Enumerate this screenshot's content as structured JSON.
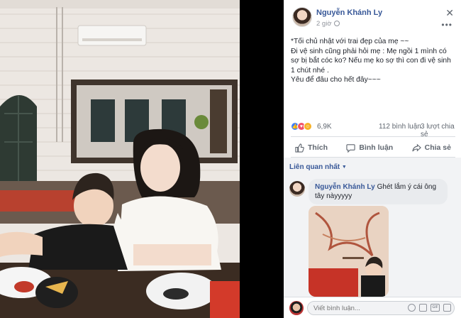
{
  "post": {
    "author": "Nguyễn Khánh Ly",
    "time": "2 giờ",
    "text": "*Tối chủ nhật với trai đẹp của mẹ ~~\nĐi vệ sinh cũng phải hỏi mẹ : Mẹ ngồi 1 mình có sợ bị bắt cóc ko? Nếu mẹ ko sợ thì con đi vệ sinh 1 chút nhé .\nYêu để đâu cho hết đây~~~",
    "reaction_count": "6,9K",
    "comment_count": "112 bình luận",
    "share_count": "3 lượt chia sẻ"
  },
  "actions": {
    "like": "Thích",
    "comment": "Bình luận",
    "share": "Chia sẻ"
  },
  "comments": {
    "sort_label": "Liên quan nhất",
    "items": [
      {
        "author": "Nguyễn Khánh Ly",
        "text": "Ghét lắm ý cái ông tây nàyyyyy"
      }
    ]
  },
  "composer": {
    "placeholder": "Viết bình luận..."
  },
  "icons": {
    "close": "close-icon",
    "more": "more-icon",
    "globe": "globe-icon"
  },
  "colors": {
    "link": "#385898",
    "like_reaction": "#4080ff",
    "love_reaction": "#f25268",
    "haha_reaction": "#f7b125"
  }
}
